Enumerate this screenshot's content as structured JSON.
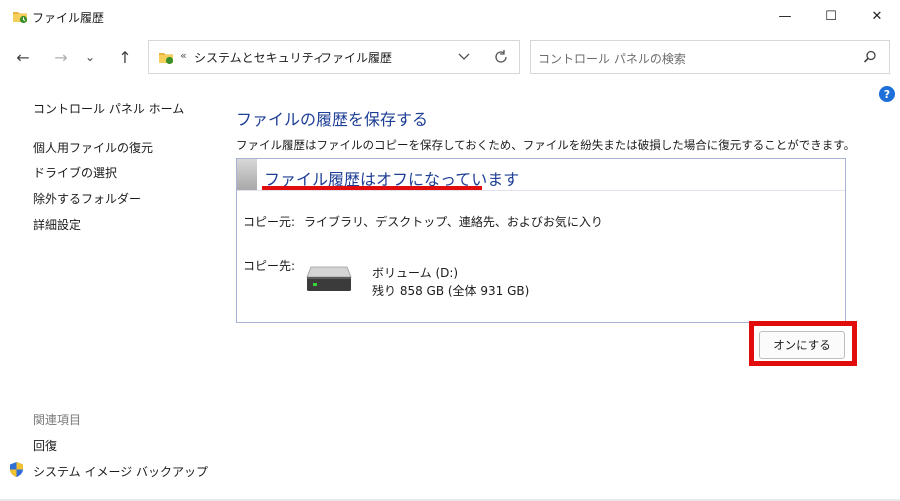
{
  "window": {
    "title": "ファイル履歴",
    "minimize": "—",
    "maximize": "☐",
    "close": "✕"
  },
  "nav": {
    "back": "←",
    "forward": "→",
    "recent": "⌄",
    "up": "↑"
  },
  "address": {
    "overflow": "«",
    "crumbs": [
      "システムとセキュリティ",
      "ファイル履歴"
    ],
    "separator": "›"
  },
  "search": {
    "placeholder": "コントロール パネルの検索"
  },
  "help_label": "?",
  "sidebar": {
    "home": "コントロール パネル ホーム",
    "items": [
      "個人用ファイルの復元",
      "ドライブの選択",
      "除外するフォルダー",
      "詳細設定"
    ],
    "related_title": "関連項目",
    "related": [
      "回復",
      "システム イメージ バックアップ"
    ]
  },
  "main": {
    "heading": "ファイルの履歴を保存する",
    "description": "ファイル履歴はファイルのコピーを保存しておくため、ファイルを紛失または破損した場合に復元することができます。",
    "status_title": "ファイル履歴はオフになっています",
    "copy_from_label": "コピー元:",
    "copy_from_value": "ライブラリ、デスクトップ、連絡先、およびお気に入り",
    "copy_to_label": "コピー先:",
    "drive": {
      "name": "ボリューム (D:)",
      "space": "残り 858 GB (全体 931 GB)"
    },
    "turn_on_button": "オンにする"
  },
  "colors": {
    "heading": "#1e3f96",
    "highlight": "#e10c0c",
    "help": "#1e6fd9"
  }
}
